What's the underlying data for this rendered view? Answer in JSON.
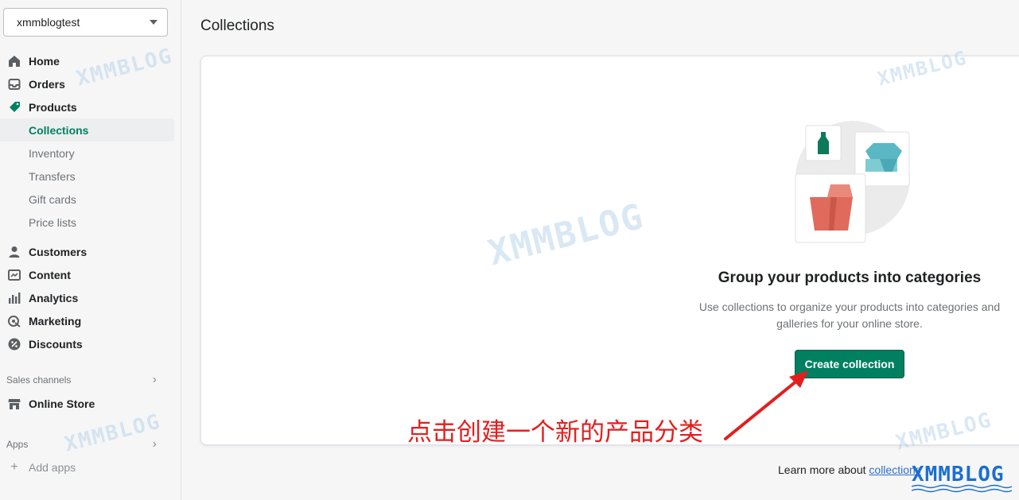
{
  "store": {
    "name": "xmmblogtest"
  },
  "nav": {
    "home": "Home",
    "orders": "Orders",
    "products": "Products",
    "product_sub": [
      "Collections",
      "Inventory",
      "Transfers",
      "Gift cards",
      "Price lists"
    ],
    "customers": "Customers",
    "content": "Content",
    "analytics": "Analytics",
    "marketing": "Marketing",
    "discounts": "Discounts",
    "sales_channels_label": "Sales channels",
    "online_store": "Online Store",
    "apps_label": "Apps",
    "add_apps": "Add apps"
  },
  "page": {
    "title": "Collections",
    "empty_heading": "Group your products into categories",
    "empty_text": "Use collections to organize your products into categories and galleries for your online store.",
    "create_button": "Create collection",
    "learn_prefix": "Learn more about ",
    "learn_link": "collections"
  },
  "annotation": "点击创建一个新的产品分类",
  "watermark": "XMMBLOG",
  "colors": {
    "accent": "#008060",
    "annotation": "#e41e1e",
    "link": "#2c6ecb"
  },
  "icons": [
    "home-icon",
    "orders-icon",
    "tag-icon",
    "person-icon",
    "content-icon",
    "analytics-icon",
    "target-icon",
    "discount-icon",
    "store-icon",
    "plus-icon",
    "chevron-right-icon",
    "chevron-down-icon"
  ]
}
